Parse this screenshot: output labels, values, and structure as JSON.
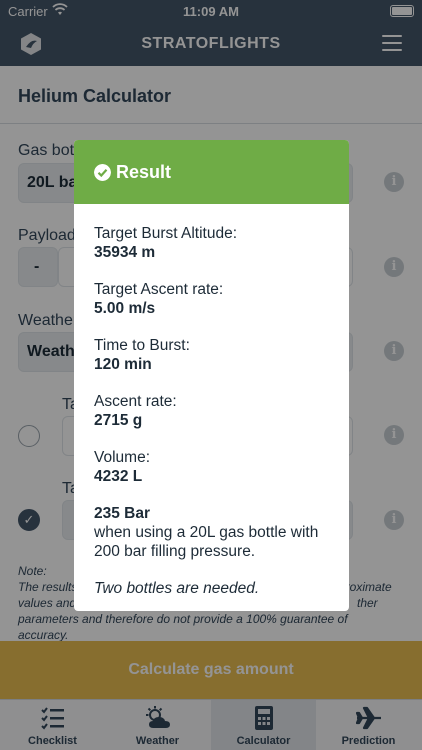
{
  "status_bar": {
    "carrier": "Carrier",
    "time": "11:09 AM"
  },
  "nav": {
    "title": "STRATOFLIGHTS",
    "logo_icon": "balloon-logo-icon",
    "menu_icon": "hamburger-menu-icon"
  },
  "page": {
    "header": "Helium Calculator",
    "gas_bottle_label": "Gas bot",
    "gas_bottle_value": "20L ba",
    "payload_label": "Payload",
    "payload_minus": "-",
    "weather_label": "Weather",
    "weather_value": "Weath",
    "option1_label": "Ta",
    "option2_label": "Ta",
    "note_title": "Note:",
    "note_line1_left": "The results",
    "note_line1_right": "proximate",
    "note_line2_left": "values and",
    "note_line2_right": "ther",
    "note_line3": "parameters and therefore do not provide a 100% guarantee of",
    "note_line4": "accuracy.",
    "calculate_button": "Calculate gas amount"
  },
  "tabs": [
    {
      "label": "Checklist",
      "icon": "checklist-icon"
    },
    {
      "label": "Weather",
      "icon": "weather-icon"
    },
    {
      "label": "Calculator",
      "icon": "calculator-icon"
    },
    {
      "label": "Prediction",
      "icon": "airplane-icon"
    }
  ],
  "modal": {
    "title": "Result",
    "items": [
      {
        "label": "Target Burst Altitude:",
        "value": "35934 m"
      },
      {
        "label": "Target Ascent rate:",
        "value": "5.00 m/s"
      },
      {
        "label": "Time to Burst:",
        "value": "120 min"
      },
      {
        "label": "Ascent rate:",
        "value": "2715 g"
      },
      {
        "label": "Volume:",
        "value": "4232 L"
      }
    ],
    "pressure_value": "235 Bar",
    "pressure_desc": "when using a 20L gas bottle with 200 bar filling pressure.",
    "bottles_note": "Two bottles are needed."
  },
  "colors": {
    "nav": "#44566a",
    "result_header": "#6fac46",
    "calculate_button": "#e8bd52"
  }
}
